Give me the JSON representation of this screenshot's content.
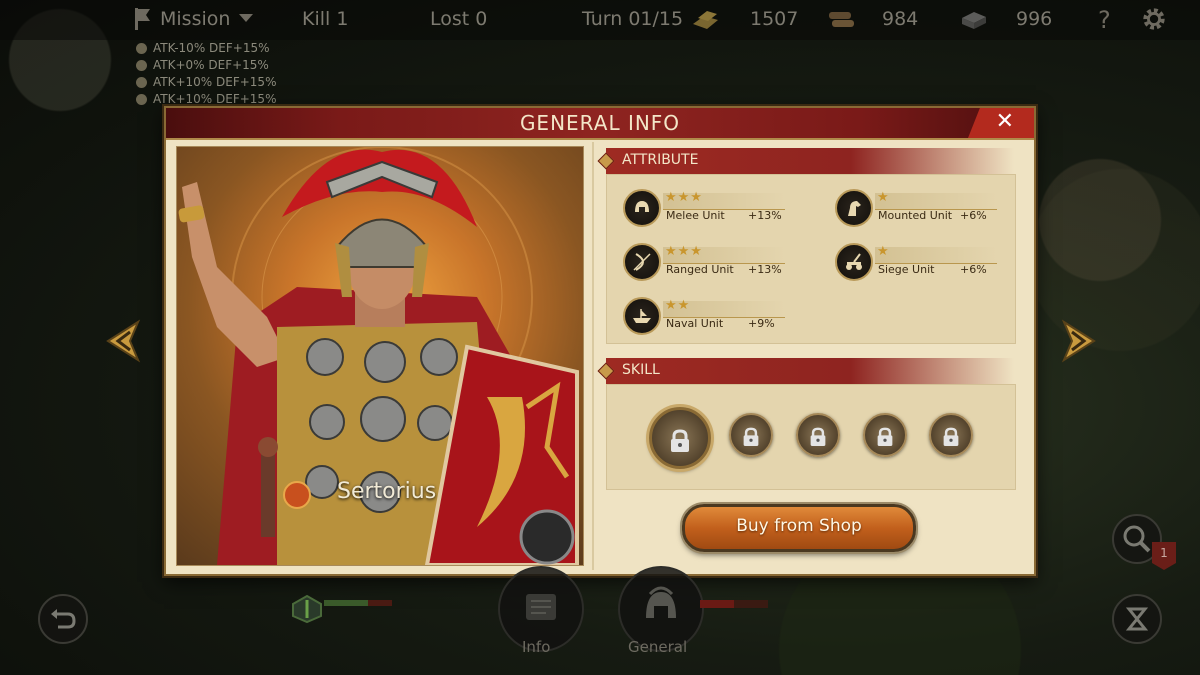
{
  "topbar": {
    "mission": "Mission",
    "kill": "Kill 1",
    "lost": "Lost 0",
    "turn": "Turn 01/15",
    "gold": "1507",
    "wood": "984",
    "iron": "996"
  },
  "buffs": [
    "ATK-10% DEF+15%",
    "ATK+0% DEF+15%",
    "ATK+10% DEF+15%",
    "ATK+10% DEF+15%"
  ],
  "dialog": {
    "title": "GENERAL INFO",
    "close": "✕",
    "general_name": "Sertorius",
    "attribute_header": "ATTRIBUTE",
    "skill_header": "SKILL",
    "buy_button": "Buy from Shop",
    "attributes": [
      {
        "label": "Melee Unit",
        "stars": "★★★",
        "bonus": "+13%",
        "icon": "helmet-icon"
      },
      {
        "label": "Mounted Unit",
        "stars": "★",
        "bonus": "+6%",
        "icon": "horse-icon"
      },
      {
        "label": "Ranged Unit",
        "stars": "★★★",
        "bonus": "+13%",
        "icon": "bow-icon"
      },
      {
        "label": "Siege Unit",
        "stars": "★",
        "bonus": "+6%",
        "icon": "catapult-icon"
      },
      {
        "label": "Naval Unit",
        "stars": "★★",
        "bonus": "+9%",
        "icon": "ship-icon"
      }
    ]
  },
  "bottom": {
    "info_label": "Info",
    "general_label": "General",
    "notification_count": "1"
  },
  "colors": {
    "accent_red": "#8e2420",
    "parchment": "#efe3c3",
    "gold": "#c9962e",
    "button_orange": "#c2601c"
  }
}
